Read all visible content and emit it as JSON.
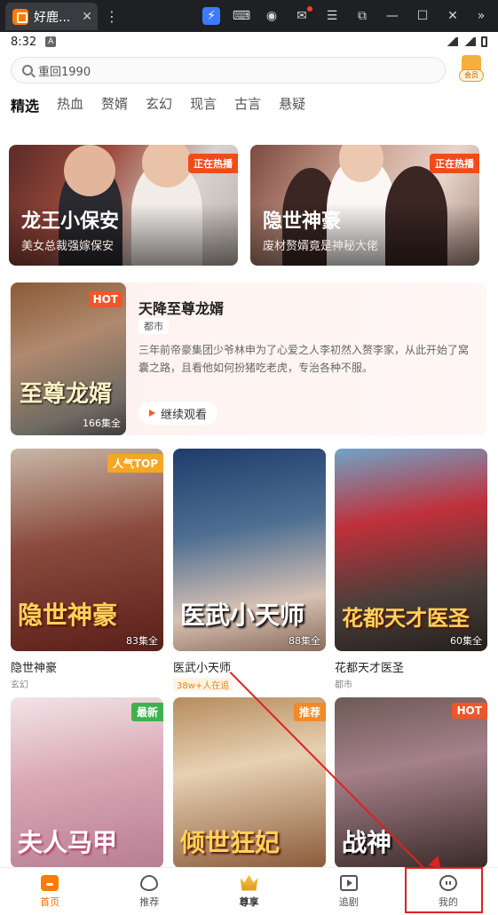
{
  "browser": {
    "tab_title": "好鹿...",
    "tab_close": "✕",
    "kebab": "⋮",
    "icons": [
      "lightning-icon",
      "gamepad-icon",
      "account-icon",
      "mail-icon",
      "menu-icon",
      "screenshot-icon",
      "minimize-icon",
      "maximize-icon",
      "close-icon",
      "expand-icon"
    ]
  },
  "status": {
    "time": "8:32",
    "badge": "A"
  },
  "search": {
    "placeholder": "重回1990"
  },
  "vip": {
    "label": "会员"
  },
  "categories": [
    "精选",
    "热血",
    "赘婿",
    "玄幻",
    "现言",
    "古言",
    "悬疑"
  ],
  "banners": [
    {
      "title": "龙王小保安",
      "sub": "美女总裁强嫁保安",
      "tag": "正在热播"
    },
    {
      "title": "隐世神豪",
      "sub": "废材赘婿竟是神秘大佬",
      "tag": "正在热播"
    }
  ],
  "feature": {
    "title": "天降至尊龙婿",
    "genre": "都市",
    "desc": "三年前帝豪集团少爷林申为了心爱之人李初然入赘李家，从此开始了窝囊之路，且看他如何扮猪吃老虎，专治各种不服。",
    "cta": "继续观看",
    "hot": "HOT",
    "episodes": "166集全",
    "poster_text": "至尊龙婿"
  },
  "grid": [
    {
      "name": "隐世神豪",
      "meta": "玄幻",
      "tag": "人气TOP",
      "tag_color": "#f5a623",
      "episodes": "83集全",
      "art": "隐世神豪"
    },
    {
      "name": "医武小天师",
      "meta": "38w+人在追",
      "tag": "",
      "tag_color": "",
      "episodes": "88集全",
      "art": "医武小天师"
    },
    {
      "name": "花都天才医圣",
      "meta": "都市",
      "tag": "",
      "tag_color": "",
      "episodes": "60集全",
      "art": "花都天才医圣"
    },
    {
      "name": "",
      "meta": "",
      "tag": "最新",
      "tag_color": "#3fb24f",
      "episodes": "",
      "art": "夫人马甲"
    },
    {
      "name": "",
      "meta": "",
      "tag": "推荐",
      "tag_color": "#f08a2a",
      "episodes": "",
      "art": "倾世狂妃"
    },
    {
      "name": "",
      "meta": "",
      "tag": "HOT",
      "tag_color": "#f2552a",
      "episodes": "",
      "art": "战神"
    }
  ],
  "bottom_nav": [
    {
      "label": "首页",
      "icon": "home-icon",
      "active": true
    },
    {
      "label": "推荐",
      "icon": "flame-icon",
      "active": false
    },
    {
      "label": "尊享",
      "icon": "crown-icon",
      "active": false
    },
    {
      "label": "追剧",
      "icon": "tv-icon",
      "active": false
    },
    {
      "label": "我的",
      "icon": "profile-icon",
      "active": false
    }
  ]
}
